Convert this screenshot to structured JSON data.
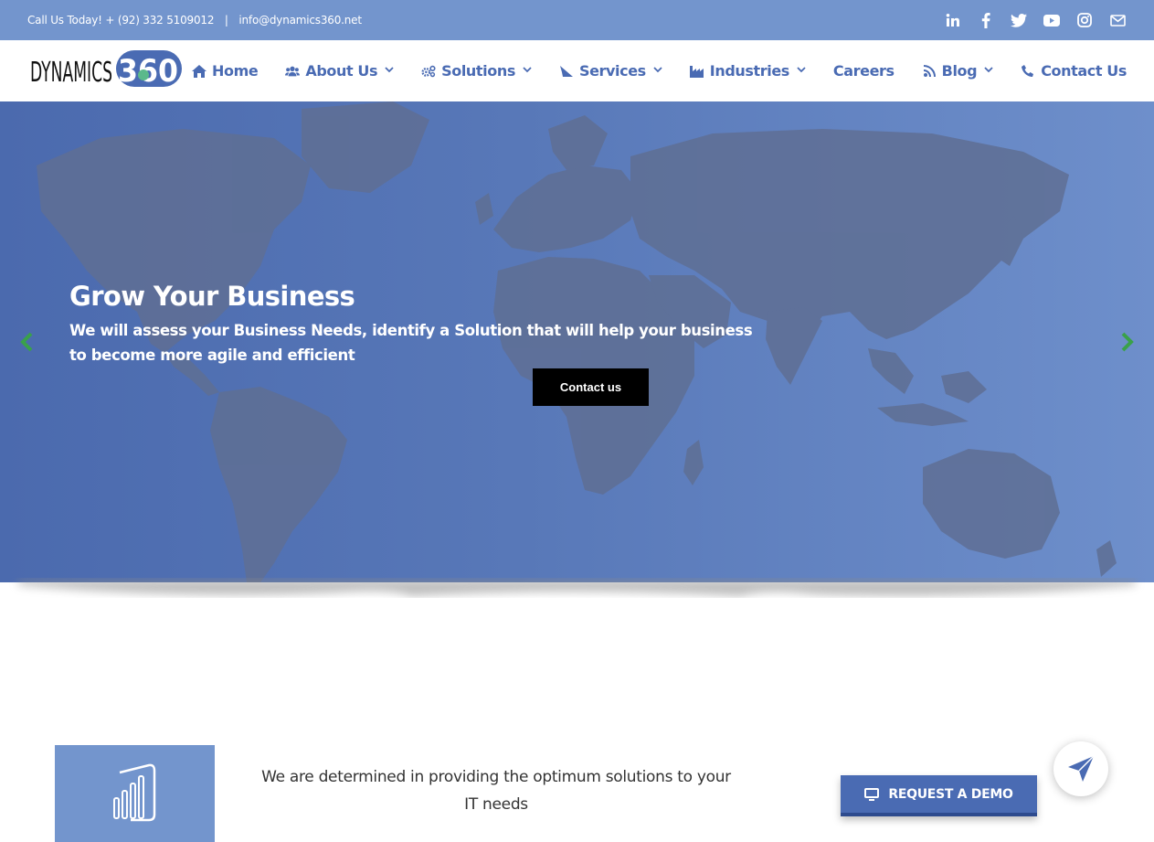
{
  "topbar": {
    "phone_text": "Call Us Today! + (92) 332 5109012",
    "separator": "|",
    "email_text": "info@dynamics360.net",
    "social_icons": [
      "linkedin-icon",
      "facebook-icon",
      "twitter-icon",
      "youtube-icon",
      "instagram-icon",
      "mail-icon"
    ]
  },
  "logo": {
    "wordmark": "DYNAMICS",
    "number": "360"
  },
  "nav": {
    "items": [
      {
        "label": "Home",
        "icon": "home-icon",
        "dropdown": false
      },
      {
        "label": "About Us",
        "icon": "users-icon",
        "dropdown": true
      },
      {
        "label": "Solutions",
        "icon": "cogs-icon",
        "dropdown": true
      },
      {
        "label": "Services",
        "icon": "send-icon",
        "dropdown": true
      },
      {
        "label": "Industries",
        "icon": "industry-icon",
        "dropdown": true
      },
      {
        "label": "Careers",
        "icon": "",
        "dropdown": false
      },
      {
        "label": "Blog",
        "icon": "rss-icon",
        "dropdown": true
      },
      {
        "label": "Contact Us",
        "icon": "phone-icon",
        "dropdown": false
      }
    ]
  },
  "hero": {
    "title": "Grow Your Business",
    "subtitle": "We will assess your Business Needs, identify a Solution that will help your business to become more agile and efficient",
    "button_label": "Contact us"
  },
  "section": {
    "mission_text": "We are determined in providing the optimum solutions to your IT needs",
    "demo_button_label": "REQUEST A DEMO"
  },
  "colors": {
    "brand_blue": "#4a6bb3",
    "topbar_blue": "#7395cd",
    "arrow_green": "#3aa14a",
    "logo_green": "#5bb98b"
  }
}
